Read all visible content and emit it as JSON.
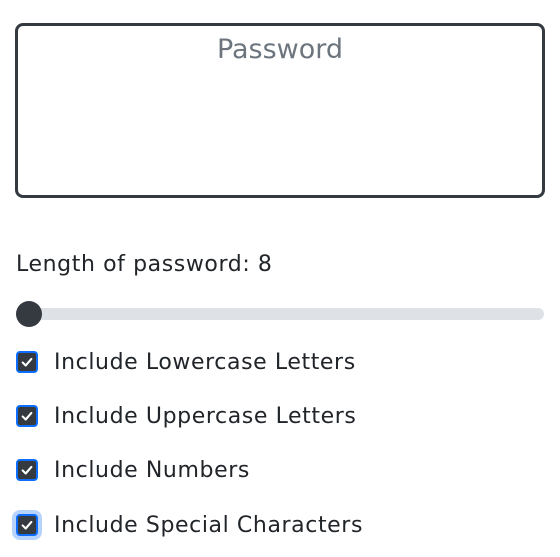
{
  "password_field": {
    "placeholder": "Password",
    "value": ""
  },
  "length_control": {
    "label": "Length of password: 8",
    "value": 8
  },
  "options": [
    {
      "label": "Include Lowercase Letters",
      "checked": true
    },
    {
      "label": "Include Uppercase Letters",
      "checked": true
    },
    {
      "label": "Include Numbers",
      "checked": true
    },
    {
      "label": "Include Special Characters",
      "checked": true,
      "focused": true
    }
  ],
  "icons": {
    "checkbox_mark": "checkmark-icon"
  },
  "colors": {
    "dark": "#343a40",
    "focus_blue": "#0d6efd",
    "track": "#dee2e6",
    "placeholder": "#6c757d",
    "text": "#212529"
  }
}
